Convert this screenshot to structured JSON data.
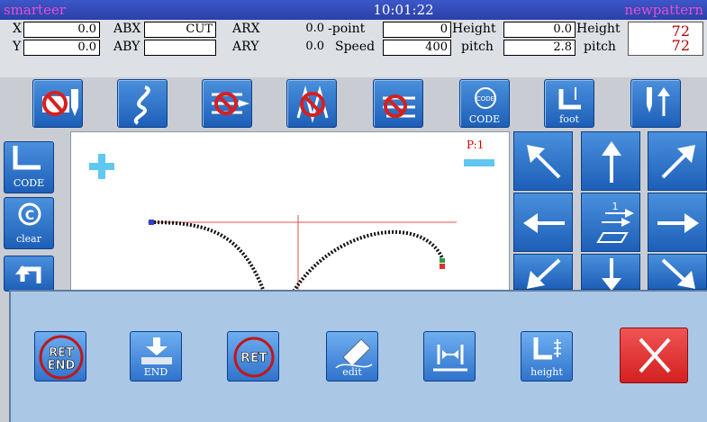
{
  "titlebar": {
    "left_label": "smarteer",
    "time": "10:01:22",
    "right_label": "newpattern"
  },
  "params": {
    "x_label": "X",
    "x_value": "0.0",
    "y_label": "Y",
    "y_value": "0.0",
    "abx_label": "ABX",
    "abx_value": "CUT",
    "aby_label": "ABY",
    "aby_value": "",
    "arx_label": "ARX",
    "arx_value": "0.0",
    "ary_label": "ARY",
    "ary_value": "0.0",
    "point_label": "-point",
    "point_value": "0",
    "speed_label": "Speed",
    "speed_value": "400",
    "height_label": "Height",
    "height_value": "0.0",
    "pitch_label": "pitch",
    "pitch_value": "2.8",
    "height2_label": "Height",
    "pitch2_label": "pitch",
    "count1": "72",
    "count2": "72"
  },
  "toolbar": {
    "code_label": "CODE",
    "foot_label": "foot"
  },
  "left": {
    "code_label": "CODE",
    "clear_label": "clear"
  },
  "canvas": {
    "page_label": "P:1"
  },
  "arrows": {
    "center_number": "1"
  },
  "popup": {
    "ret_end_text_top": "RET",
    "ret_end_text_bottom": "END",
    "end_label": "END",
    "ret_text": "RET",
    "edit_label": "edit",
    "height_label": "height"
  },
  "colors": {
    "button_blue": "#2f73cc",
    "close_red": "#d32020",
    "title_magenta": "#e94cd0",
    "count_red": "#b00000",
    "page_label_red": "#d40000",
    "popup_bg": "#abc7e6"
  }
}
